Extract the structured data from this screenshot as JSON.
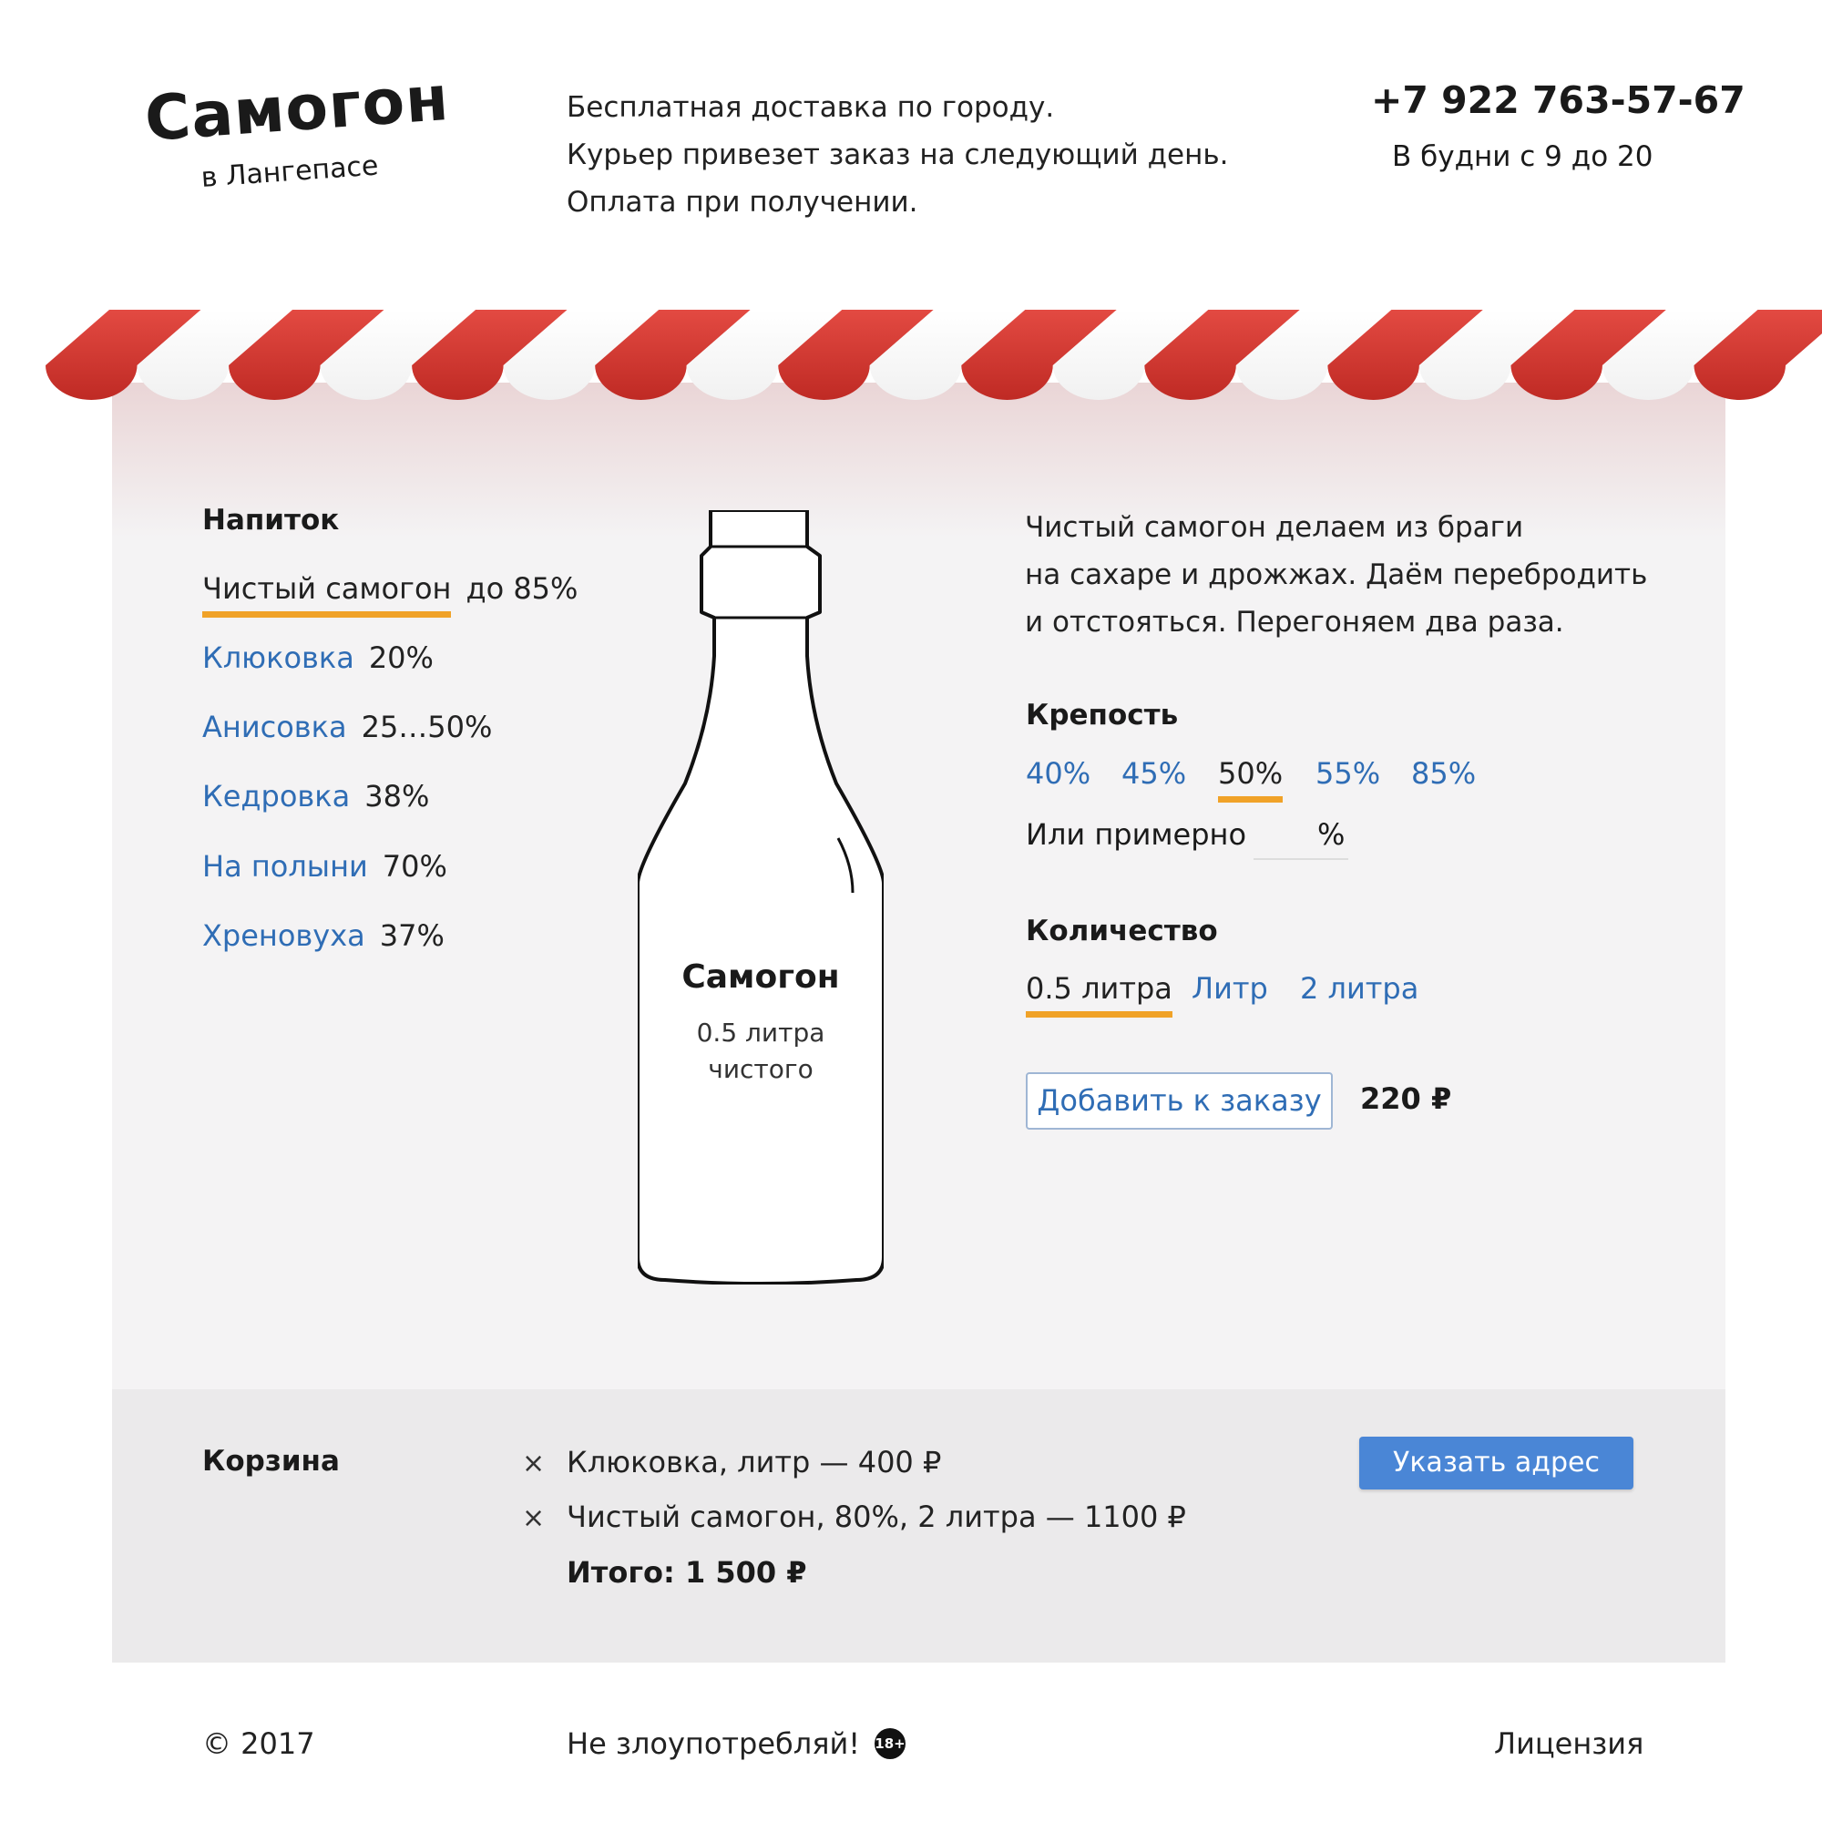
{
  "header": {
    "logo_title": "Самогон",
    "logo_subtitle": "в Лангепасе",
    "delivery_lines": [
      "Бесплатная доставка по городу.",
      "Курьер привезет заказ на следующий день.",
      "Оплата при получении."
    ],
    "phone": "+7 922 763-57-67",
    "hours": "В будни с 9 до 20"
  },
  "drinks": {
    "title": "Напиток",
    "items": [
      {
        "name": "Чистый самогон",
        "strength": "до 85%",
        "selected": true
      },
      {
        "name": "Клюковка",
        "strength": "20%",
        "selected": false
      },
      {
        "name": "Анисовка",
        "strength": "25…50%",
        "selected": false
      },
      {
        "name": "Кедровка",
        "strength": "38%",
        "selected": false
      },
      {
        "name": "На полыни",
        "strength": "70%",
        "selected": false
      },
      {
        "name": "Хреновуха",
        "strength": "37%",
        "selected": false
      }
    ]
  },
  "bottle": {
    "title": "Самогон",
    "subtitle_line1": "0.5 литра",
    "subtitle_line2": "чистого"
  },
  "product": {
    "description": [
      "Чистый самогон делаем из браги",
      "на сахаре и дрожжах. Даём перебродить",
      "и отстояться. Перегоняем два раза."
    ],
    "strength_title": "Крепость",
    "strength_options": [
      "40%",
      "45%",
      "50%",
      "55%",
      "85%"
    ],
    "strength_selected": "50%",
    "approx_label": "Или примерно",
    "approx_value": "",
    "approx_unit": "%",
    "quantity_title": "Количество",
    "quantity_options": [
      "0.5 литра",
      "Литр",
      "2 литра"
    ],
    "quantity_selected": "0.5 литра",
    "add_button": "Добавить к заказу",
    "price": "220 ₽"
  },
  "cart": {
    "title": "Корзина",
    "remove_symbol": "×",
    "items": [
      "Клюковка, литр — 400 ₽",
      "Чистый самогон, 80%, 2 литра — 1100 ₽"
    ],
    "total": "Итого: 1 500 ₽",
    "address_button": "Указать адрес"
  },
  "footer": {
    "copyright": "© 2017",
    "warning": "Не злоупотребляй!",
    "age_badge": "18+",
    "license": "Лицензия"
  },
  "colors": {
    "awning_red": "#d63a33",
    "accent_underline": "#f0a228",
    "link": "#2f6db5",
    "primary_button": "#4a86d6",
    "panel": "#f4f3f4",
    "cart": "#ebeaeb"
  }
}
